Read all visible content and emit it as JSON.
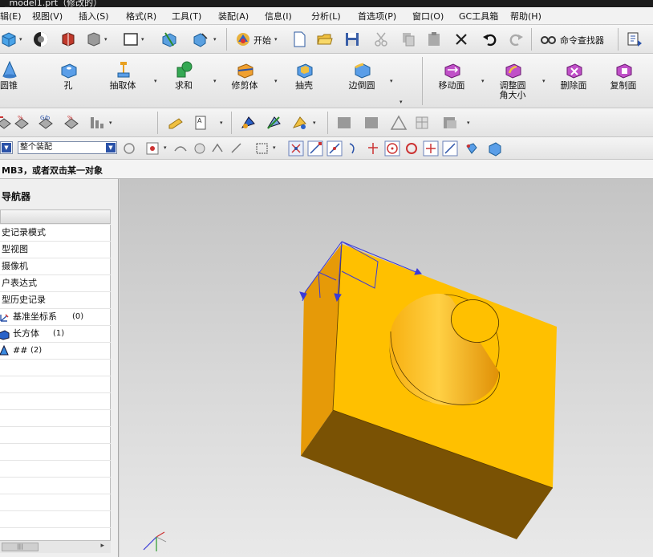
{
  "window": {
    "title": "_model1.prt（修改的）"
  },
  "menu": {
    "items": [
      {
        "label": "辑(E)"
      },
      {
        "label": "视图(V)"
      },
      {
        "label": "插入(S)"
      },
      {
        "label": "格式(R)"
      },
      {
        "label": "工具(T)"
      },
      {
        "label": "装配(A)"
      },
      {
        "label": "信息(I)"
      },
      {
        "label": "分析(L)"
      },
      {
        "label": "首选项(P)"
      },
      {
        "label": "窗口(O)"
      },
      {
        "label": "GC工具箱"
      },
      {
        "label": "帮助(H)"
      }
    ]
  },
  "toolbar_standard": {
    "start_label": "开始",
    "command_finder_label": "命令查找器"
  },
  "toolbar_features": {
    "buttons": [
      {
        "label": "圆锥",
        "icon": "cone-icon"
      },
      {
        "label": "孔",
        "icon": "hole-icon"
      },
      {
        "label": "抽取体",
        "icon": "extract-body-icon"
      },
      {
        "label": "求和",
        "icon": "unite-icon"
      },
      {
        "label": "修剪体",
        "icon": "trim-body-icon"
      },
      {
        "label": "抽壳",
        "icon": "shell-icon"
      },
      {
        "label": "边倒圆",
        "icon": "edge-blend-icon"
      },
      {
        "label": "移动面",
        "icon": "move-face-icon"
      },
      {
        "label": "调整圆角大小",
        "icon": "resize-blend-icon"
      },
      {
        "label": "删除面",
        "icon": "delete-face-icon"
      },
      {
        "label": "复制面",
        "icon": "copy-face-icon"
      }
    ]
  },
  "selection_bar": {
    "filter_value": "",
    "scope_value": "整个装配"
  },
  "cue_line": {
    "text": "MB3，或者双击某一对象"
  },
  "part_navigator": {
    "title": "导航器",
    "rows": [
      {
        "label": "史记录模式"
      },
      {
        "label": "型视图"
      },
      {
        "label": "摄像机"
      },
      {
        "label": "户表达式"
      },
      {
        "label": "型历史记录"
      },
      {
        "label": "基准坐标系",
        "suffix": "(0)",
        "icon": "datum-csys-icon"
      },
      {
        "label": "长方体",
        "suffix": "(1)",
        "icon": "block-icon"
      },
      {
        "label": "##",
        "suffix": "(2)",
        "icon": "cone-icon"
      }
    ]
  },
  "colors": {
    "model_face": "#FFC000",
    "model_side": "#E69A08",
    "model_bottom": "#7A5204",
    "csys_blue": "#3a3ad8"
  }
}
